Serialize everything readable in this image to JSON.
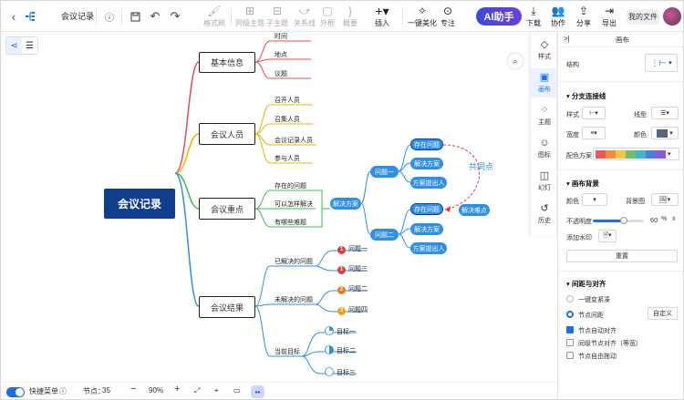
{
  "toolbar": {
    "back_icon": "chevron-left-icon",
    "file_name": "会议记录",
    "menu_icon": "structure-icon",
    "buttons": [
      {
        "name": "format-brush",
        "label": "格式刷",
        "icon": "brush-icon"
      },
      {
        "name": "sibling-topic",
        "label": "同级主题",
        "icon": "sibling-topic-icon"
      },
      {
        "name": "child-topic",
        "label": "子主题",
        "icon": "child-topic-icon"
      },
      {
        "name": "relation",
        "label": "关系线",
        "icon": "relation-icon"
      },
      {
        "name": "outline",
        "label": "外框",
        "icon": "outline-box-icon"
      },
      {
        "name": "summary",
        "label": "概要",
        "icon": "summary-icon"
      },
      {
        "name": "insert",
        "label": "插入",
        "icon": "plus-icon"
      },
      {
        "name": "beautify",
        "label": "一键美化",
        "icon": "magic-wand-icon"
      },
      {
        "name": "focus",
        "label": "专注",
        "icon": "focus-icon"
      }
    ],
    "ai_label": "AI助手",
    "right_buttons": [
      {
        "name": "download",
        "label": "下载",
        "icon": "download-icon"
      },
      {
        "name": "collab",
        "label": "协作",
        "icon": "collab-icon"
      },
      {
        "name": "share",
        "label": "分享",
        "icon": "share-icon"
      },
      {
        "name": "export",
        "label": "导出",
        "icon": "export-icon"
      }
    ],
    "my_files": "我的文件"
  },
  "mindmap": {
    "root": "会议记录",
    "branches": [
      {
        "label": "基本信息",
        "color": "#e84b4b",
        "leaves": [
          "时间",
          "地点",
          "议题"
        ]
      },
      {
        "label": "会议人员",
        "color": "#f0b400",
        "leaves": [
          "召开人员",
          "召集人员",
          "会议记录人员",
          "参与人员"
        ]
      },
      {
        "label": "会议重点",
        "color": "#3dbb5a",
        "leaves": [
          "存在的问题",
          "可以怎样解决",
          "有哪些难题"
        ]
      },
      {
        "label": "会议结果",
        "color": "#2e8fe6",
        "groups": [
          {
            "label": "已解决的问题",
            "items": [
              {
                "num": "1",
                "text": "问题一",
                "color": "#e23c3c"
              },
              {
                "num": "1",
                "text": "问题三",
                "color": "#e23c3c"
              }
            ]
          },
          {
            "label": "未解决的问题",
            "items": [
              {
                "num": "2",
                "text": "问题二",
                "color": "#f07a1a"
              },
              {
                "num": "3",
                "text": "问题四",
                "color": "#f0a400"
              }
            ]
          },
          {
            "label": "当前目标",
            "items": [
              {
                "text": "目标一",
                "progress": 0.25
              },
              {
                "text": "目标二",
                "progress": 0.5
              },
              {
                "text": "目标三",
                "progress": 0
              }
            ]
          }
        ]
      }
    ],
    "solution": {
      "label": "解决方案",
      "problems": [
        {
          "label": "问题一",
          "children": [
            "存在问题",
            "解决方案",
            "方案提出人"
          ]
        },
        {
          "label": "问题二",
          "children": [
            "存在问题",
            "解决方案",
            "方案提出人"
          ]
        }
      ],
      "callout": "解决难点",
      "relation_label": "共同点"
    }
  },
  "side_tabs": [
    {
      "label": "样式",
      "icon": "style-icon"
    },
    {
      "label": "画布",
      "icon": "canvas-icon",
      "active": true
    },
    {
      "label": "主题",
      "icon": "theme-icon"
    },
    {
      "label": "图标",
      "icon": "smile-icon"
    },
    {
      "label": "幻灯",
      "icon": "slides-icon"
    },
    {
      "label": "历史",
      "icon": "history-icon"
    }
  ],
  "panel": {
    "title": "画布",
    "structure_label": "结构",
    "branch_section": "分支连接线",
    "style_label": "样式",
    "line_type_label": "线型",
    "width_label": "宽度",
    "color_label": "颜色",
    "scheme_label": "配色方案",
    "scheme_colors": [
      "#e85a5a",
      "#f08c3c",
      "#f5c542",
      "#6cc36a",
      "#3fb5c8",
      "#4a7fe0",
      "#8a5ad8"
    ],
    "bg_section": "画布背景",
    "bg_color_label": "颜色",
    "bg_image_label": "背景图",
    "opacity_label": "不透明度",
    "opacity_value": "60",
    "opacity_unit": "%",
    "opacity_level": 0.6,
    "watermark_label": "添加水印",
    "reset_label": "重置",
    "layout_section": "间距与对齐",
    "uniform_label": "一键变紧凑",
    "spacing_label": "节点间距",
    "custom_label": "自定义",
    "auto_align_label": "节点自动对齐",
    "same_level_label": "同级节点对齐（等宽）",
    "free_drag_label": "节点自由拖动"
  },
  "status": {
    "quick_label": "快捷菜单",
    "node_label": "节点：",
    "node_count": "35",
    "zoom": "90%"
  }
}
